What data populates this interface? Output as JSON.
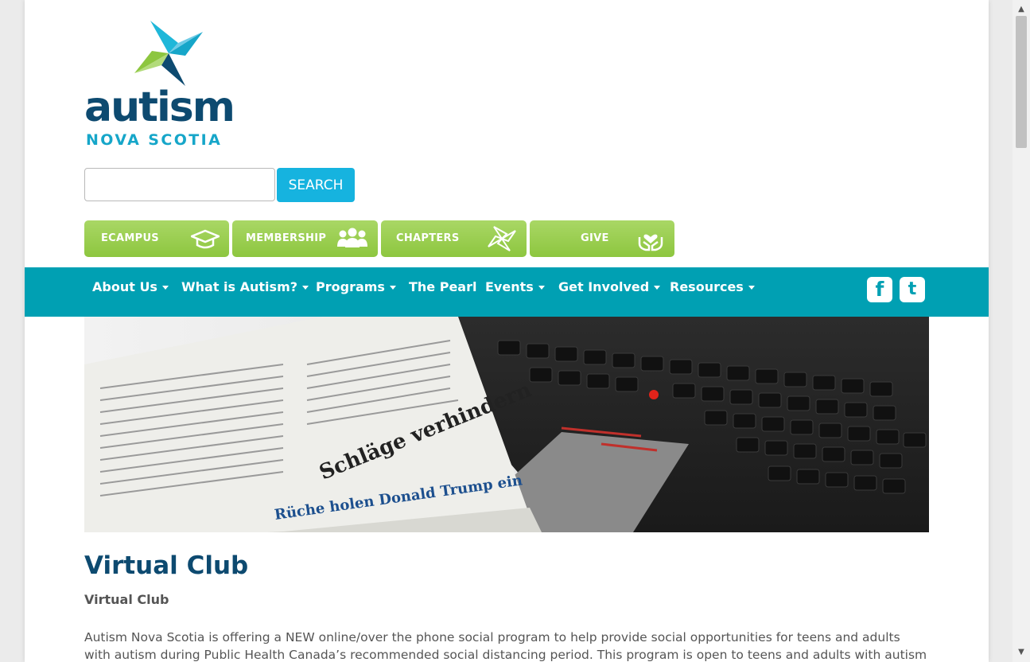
{
  "logo": {
    "word": "autism",
    "sub": "NOVA SCOTIA"
  },
  "search": {
    "value": "",
    "placeholder": "",
    "button_label": "SEARCH"
  },
  "quick_links": [
    {
      "label": "ECAMPUS",
      "icon": "graduation-cap-icon"
    },
    {
      "label": "MEMBERSHIP",
      "icon": "group-icon"
    },
    {
      "label": "CHAPTERS",
      "icon": "pinwheel-icon"
    },
    {
      "label": "GIVE",
      "icon": "heart-hands-icon"
    }
  ],
  "nav": {
    "items": [
      {
        "label": "About Us",
        "dropdown": true
      },
      {
        "label": "What is Autism?",
        "dropdown": true
      },
      {
        "label": "Programs",
        "dropdown": true
      },
      {
        "label": "The Pearl",
        "dropdown": false
      },
      {
        "label": "Events",
        "dropdown": true
      },
      {
        "label": "Get Involved",
        "dropdown": true
      },
      {
        "label": "Resources",
        "dropdown": true
      }
    ],
    "social": [
      {
        "label": "f",
        "icon": "facebook-icon"
      },
      {
        "label": "t",
        "icon": "twitter-icon"
      }
    ]
  },
  "hero": {
    "headline": "Schläge verhindern",
    "caption": "Rüche holen Donald Trump ein",
    "alt": "Newspaper resting on a laptop keyboard"
  },
  "content": {
    "title": "Virtual Club",
    "subtitle": "Virtual Club",
    "paragraph": "Autism Nova Scotia is offering a NEW online/over the phone social program to help provide social opportunities for teens and adults with autism during Public Health Canada’s recommended social distancing period. This program is open to teens and adults with autism across"
  },
  "colors": {
    "nav_bg": "#00a0b3",
    "search_button": "#16b3df",
    "quick_button_green": "#8dc63f",
    "title_color": "#0d4a70",
    "body_text": "#555555"
  }
}
